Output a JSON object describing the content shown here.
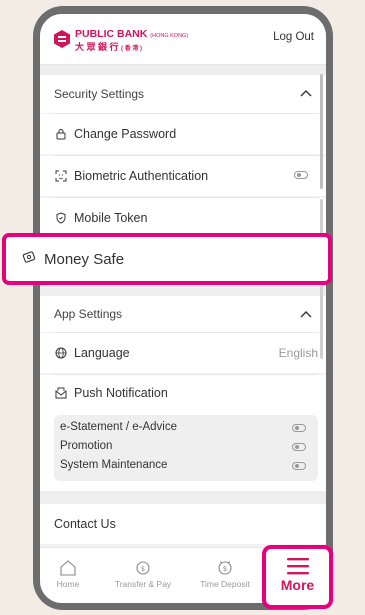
{
  "header": {
    "bank_name_en": "PUBLIC BANK",
    "bank_region_en": "(HONG KONG)",
    "bank_name_zh": "大 眾 銀 行",
    "bank_region_zh": "( 香 港 )",
    "logout_label": "Log Out"
  },
  "security": {
    "title": "Security Settings",
    "items": [
      {
        "label": "Change Password",
        "icon": "lock-icon"
      },
      {
        "label": "Biometric Authentication",
        "icon": "face-id-icon",
        "toggle": false
      },
      {
        "label": "Mobile Token",
        "icon": "shield-icon"
      }
    ],
    "money_safe_label": "Money Safe"
  },
  "app_settings": {
    "title": "App Settings",
    "language_label": "Language",
    "language_value": "English",
    "push_label": "Push Notification",
    "push_options": [
      {
        "label": "e-Statement / e-Advice",
        "on": false
      },
      {
        "label": "Promotion",
        "on": false
      },
      {
        "label": "System Maintenance",
        "on": false
      }
    ]
  },
  "contact_label": "Contact Us",
  "tabs": [
    {
      "label": "Home",
      "icon": "home-icon"
    },
    {
      "label": "Transfer & Pay",
      "icon": "transfer-pay-icon"
    },
    {
      "label": "Time Deposit",
      "icon": "time-deposit-icon"
    },
    {
      "label": "More",
      "icon": "menu-icon"
    }
  ],
  "colors": {
    "highlight": "#e6007e",
    "brand_red": "#d0155b"
  }
}
